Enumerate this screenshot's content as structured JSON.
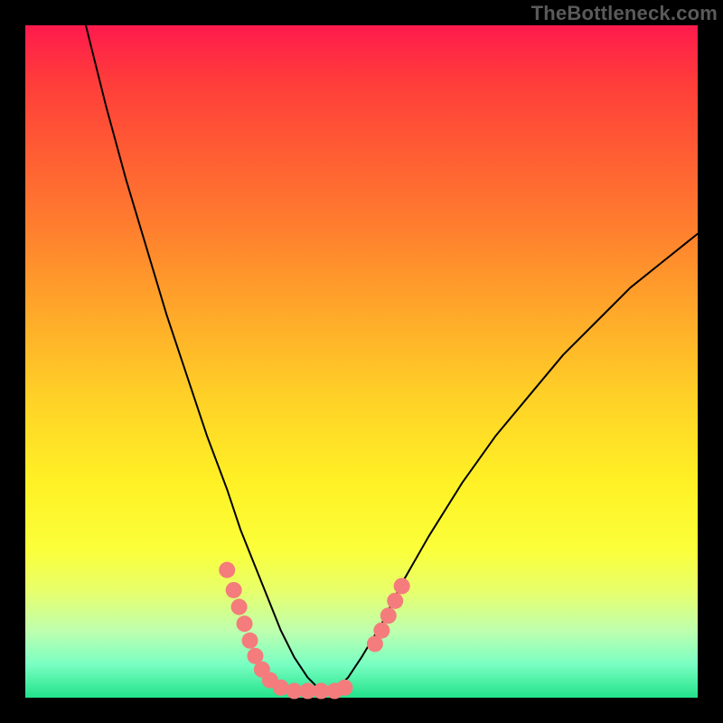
{
  "watermark": "TheBottleneck.com",
  "chart_data": {
    "type": "line",
    "title": "",
    "xlabel": "",
    "ylabel": "",
    "xlim": [
      0,
      100
    ],
    "ylim": [
      0,
      100
    ],
    "grid": false,
    "series": [
      {
        "name": "bottleneck-curve",
        "x": [
          9,
          12,
          15,
          18,
          21,
          24,
          27,
          30,
          32,
          34,
          36,
          38,
          40,
          42,
          44,
          46,
          48,
          50,
          53,
          56,
          60,
          65,
          70,
          75,
          80,
          85,
          90,
          95,
          100
        ],
        "y": [
          100,
          88,
          77,
          67,
          57,
          48,
          39,
          31,
          25,
          20,
          15,
          10,
          6,
          3,
          1,
          1,
          3,
          6,
          11,
          17,
          24,
          32,
          39,
          45,
          51,
          56,
          61,
          65,
          69
        ],
        "stroke": "#000000",
        "stroke_width": 2
      }
    ],
    "markers": [
      {
        "name": "left-cluster",
        "shape": "circle",
        "color": "#f47c7c",
        "radius_px": 9,
        "points_xy": [
          [
            30,
            19
          ],
          [
            31,
            16
          ],
          [
            31.8,
            13.5
          ],
          [
            32.6,
            11
          ],
          [
            33.4,
            8.5
          ],
          [
            34.2,
            6.2
          ],
          [
            35.2,
            4.2
          ],
          [
            36.4,
            2.6
          ],
          [
            38,
            1.5
          ],
          [
            40,
            1
          ],
          [
            42,
            1
          ],
          [
            44,
            1
          ],
          [
            46,
            1
          ],
          [
            47.5,
            1.5
          ]
        ]
      },
      {
        "name": "right-cluster",
        "shape": "circle",
        "color": "#f47c7c",
        "radius_px": 9,
        "points_xy": [
          [
            52,
            8
          ],
          [
            53,
            10
          ],
          [
            54,
            12.2
          ],
          [
            55,
            14.4
          ],
          [
            56,
            16.6
          ]
        ]
      }
    ]
  }
}
